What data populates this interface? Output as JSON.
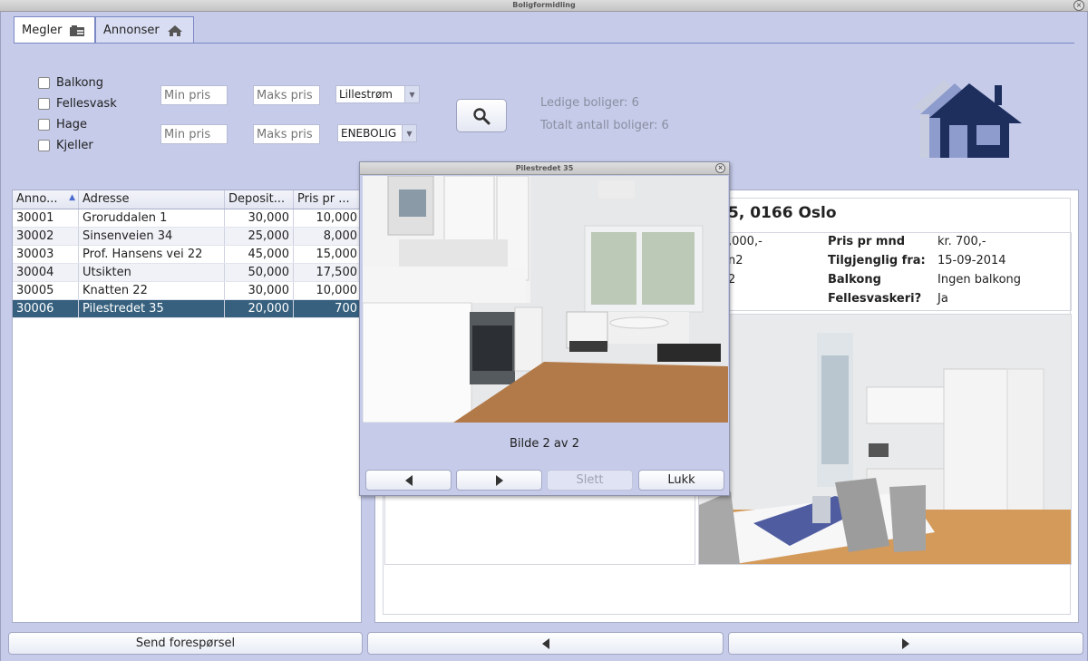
{
  "window": {
    "title": "Boligformidling"
  },
  "tabs": [
    {
      "label": "Megler",
      "icon": "briefcase-icon"
    },
    {
      "label": "Annonser",
      "icon": "home-icon"
    }
  ],
  "filters": {
    "checkboxes": [
      "Balkong",
      "Fellesvask",
      "Hage",
      "Kjeller"
    ],
    "min_price_placeholder": "Min pris",
    "max_price_placeholder": "Maks pris",
    "city_select": "Lillestrøm",
    "type_select": "ENEBOLIG",
    "search_icon": "search-icon"
  },
  "stats": {
    "available": "Ledige boliger: 6",
    "total": "Totalt antall boliger: 6"
  },
  "logo": {
    "icon": "house-logo-icon",
    "color": "#1e2f5e"
  },
  "table": {
    "headers": [
      "Anno...",
      "Adresse",
      "Deposit...",
      "Pris pr ..."
    ],
    "rows": [
      [
        "30001",
        "Groruddalen 1",
        "30,000",
        "10,000"
      ],
      [
        "30002",
        "Sinsenveien 34",
        "25,000",
        "8,000"
      ],
      [
        "30003",
        "Prof. Hansens vei 22",
        "45,000",
        "15,000"
      ],
      [
        "30004",
        "Utsikten",
        "50,000",
        "17,500"
      ],
      [
        "30005",
        "Knatten 22",
        "30,000",
        "10,000"
      ],
      [
        "30006",
        "Pilestredet 35",
        "20,000",
        "700"
      ]
    ],
    "selected_row": 5,
    "selection_color": "#36607e"
  },
  "detail": {
    "address": "5, 0166 Oslo",
    "left_values": [
      ",000,-",
      "n2",
      "2"
    ],
    "labels": [
      "Pris pr mnd",
      "Tilgjenglig fra:",
      "Balkong",
      "Fellesvaskeri?"
    ],
    "values": [
      "kr. 700,-",
      "15-09-2014",
      "Ingen balkong",
      "Ja"
    ]
  },
  "bottom": {
    "send": "Send forespørsel",
    "prev_icon": "arrow-left-icon",
    "next_icon": "arrow-right-icon"
  },
  "dialog": {
    "title": "Pilestredet 35",
    "caption": "Bilde 2 av 2",
    "buttons": {
      "delete": "Slett",
      "close": "Lukk"
    }
  }
}
